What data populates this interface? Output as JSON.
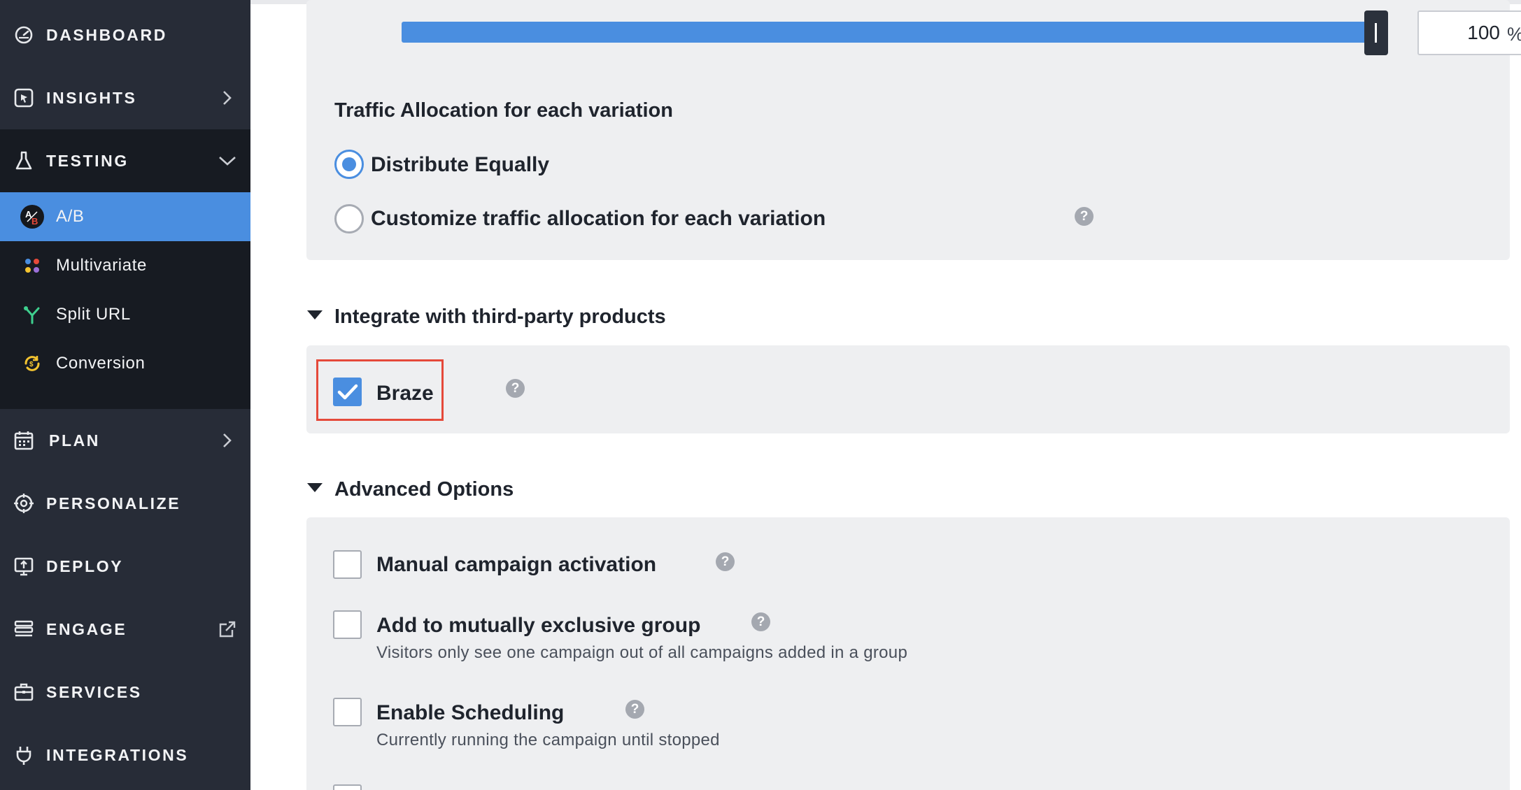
{
  "sidebar": {
    "items": [
      {
        "label": "DASHBOARD",
        "icon": "dashboard-gauge-icon"
      },
      {
        "label": "INSIGHTS",
        "icon": "insights-cursor-icon"
      },
      {
        "label": "TESTING",
        "icon": "flask-icon"
      },
      {
        "label": "PLAN",
        "icon": "calendar-icon"
      },
      {
        "label": "PERSONALIZE",
        "icon": "target-icon"
      },
      {
        "label": "DEPLOY",
        "icon": "deploy-monitor-icon"
      },
      {
        "label": "ENGAGE",
        "icon": "engage-stack-icon"
      },
      {
        "label": "SERVICES",
        "icon": "briefcase-icon"
      },
      {
        "label": "INTEGRATIONS",
        "icon": "plug-icon"
      }
    ],
    "testing_sub": [
      {
        "label": "A/B",
        "icon": "ab-test-icon"
      },
      {
        "label": "Multivariate",
        "icon": "multivariate-dots-icon"
      },
      {
        "label": "Split URL",
        "icon": "split-url-icon"
      },
      {
        "label": "Conversion",
        "icon": "conversion-icon"
      }
    ]
  },
  "traffic": {
    "percent_value": "100",
    "percent_sign": "%",
    "slider_fraction": 1.0,
    "allocation_heading": "Traffic Allocation for each variation",
    "options": [
      {
        "label": "Distribute Equally",
        "selected": true
      },
      {
        "label": "Customize traffic allocation for each variation",
        "selected": false
      }
    ]
  },
  "integrations": {
    "heading": "Integrate with third-party products",
    "braze_label": "Braze",
    "braze_checked": true
  },
  "advanced": {
    "heading": "Advanced Options",
    "options": [
      {
        "label": "Manual campaign activation",
        "desc": "",
        "checked": false
      },
      {
        "label": "Add to mutually exclusive group",
        "desc": "Visitors only see one campaign out of all campaigns added in a group",
        "checked": false
      },
      {
        "label": "Enable Scheduling",
        "desc": "Currently running the campaign until stopped",
        "checked": false
      }
    ]
  },
  "help_glyph": "?",
  "colors": {
    "accent": "#4a8ee0",
    "sidebar_bg": "#272c37",
    "sidebar_active_bg": "#171b22",
    "highlight": "#e5493a",
    "panel_bg": "#eeeff1"
  }
}
